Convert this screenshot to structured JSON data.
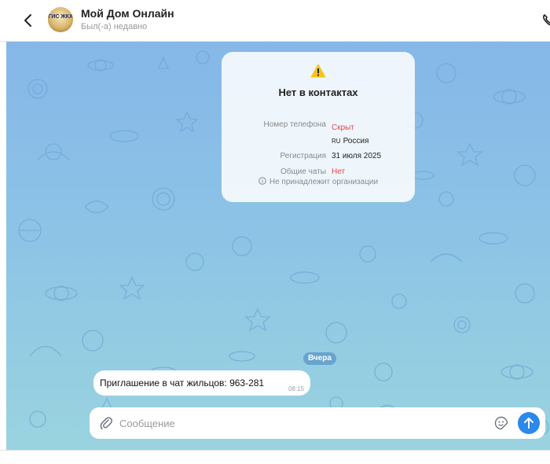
{
  "header": {
    "title": "Мой Дом Онлайн",
    "status": "Был(-а) недавно",
    "avatar_text": "ГИС ЖКХ"
  },
  "contact_card": {
    "title": "Нет в контактах",
    "rows": [
      {
        "label": "Номер телефона",
        "value": "Скрыт",
        "value_color": "#e5484d"
      },
      {
        "label": "",
        "flag": "RU",
        "value": "Россия"
      },
      {
        "label": "Регистрация",
        "value": "31 июля 2025"
      },
      {
        "label": "Общие чаты",
        "value": "Нет",
        "value_color": "#e5484d"
      }
    ],
    "org_note": "Не принадлежит организации"
  },
  "date_divider": "Вчера",
  "messages": [
    {
      "text": "Приглашение в чат жильцов: 963-281",
      "time": "08:15"
    }
  ],
  "composer": {
    "placeholder": "Сообщение",
    "value": ""
  },
  "colors": {
    "accent": "#2a89ea",
    "warning": "#f5c518",
    "danger": "#e5484d"
  }
}
